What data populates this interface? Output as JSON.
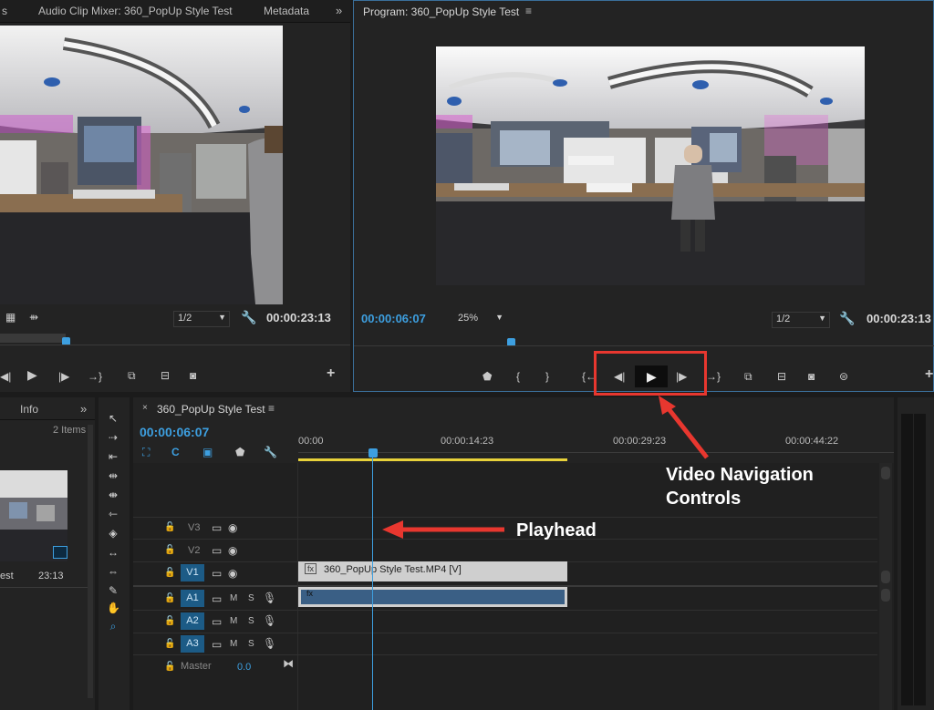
{
  "source_monitor": {
    "tab_audio_mixer": "Audio Clip Mixer: 360_PopUp Style Test",
    "tab_metadata": "Metadata",
    "tab_left_fragment": "s",
    "resolution": "1/2",
    "duration": "00:00:23:13"
  },
  "program_monitor": {
    "title": "Program: 360_PopUp Style Test",
    "timecode": "00:00:06:07",
    "zoom": "25%",
    "resolution": "1/2",
    "duration": "00:00:23:13"
  },
  "project_panel": {
    "tab_info": "Info",
    "items_count": "2 Items",
    "clip_name_fragment": "est",
    "clip_duration": "23:13"
  },
  "timeline": {
    "sequence_name": "360_PopUp Style Test",
    "timecode": "00:00:06:07",
    "ruler": [
      "00:00",
      "00:00:14:23",
      "00:00:29:23",
      "00:00:44:22"
    ],
    "video_tracks": [
      {
        "label": "V3",
        "target": ""
      },
      {
        "label": "V2",
        "target": ""
      },
      {
        "label": "V1",
        "target": "V1"
      }
    ],
    "audio_tracks": [
      {
        "label": "A1",
        "target": "A1"
      },
      {
        "label": "A2",
        "target": "A2"
      },
      {
        "label": "A3",
        "target": "A3"
      }
    ],
    "master_label": "Master",
    "master_value": "0.0",
    "clip_label": "360_PopUp Style Test.MP4 [V]",
    "fx_label": "fx",
    "mute_label": "M",
    "solo_label": "S"
  },
  "annotations": {
    "nav_controls_line1": "Video Navigation",
    "nav_controls_line2": "Controls",
    "playhead": "Playhead"
  },
  "colors": {
    "accent_blue": "#3d9fe0",
    "annotation_red": "#e8372f",
    "track_target_blue": "#1c5b86",
    "work_area_yellow": "#e8d23a"
  }
}
